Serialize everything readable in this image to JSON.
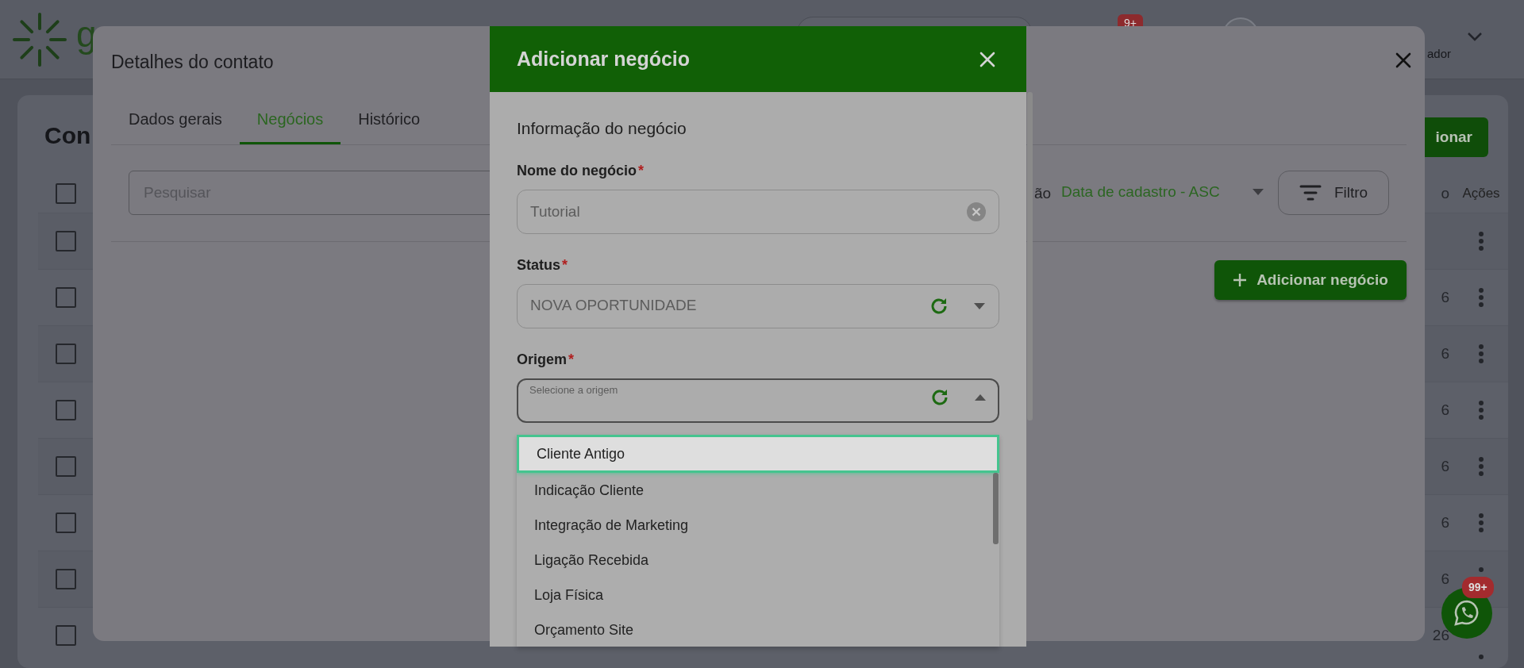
{
  "header": {
    "logo_text": "g",
    "notification_badge": "9+",
    "user_role": "ador"
  },
  "page": {
    "title": "Con",
    "add_button": "ionar",
    "header_checkbox": {
      "checked": false
    },
    "columns": [
      "o",
      "Ações"
    ],
    "rows": [
      {
        "checked": false
      },
      {
        "checked": false,
        "column_1": "6"
      },
      {
        "checked": false,
        "column_1": "6"
      },
      {
        "checked": false,
        "column_1": "6"
      },
      {
        "checked": false,
        "column_1": "6"
      },
      {
        "checked": false,
        "column_1": "6"
      },
      {
        "checked": false,
        "column_1": "6"
      },
      {
        "checked": false,
        "column_1": "26"
      }
    ]
  },
  "contact_modal": {
    "title": "Detalhes do contato",
    "tabs": [
      {
        "label": "Dados gerais",
        "selected": false
      },
      {
        "label": "Negócios",
        "selected": true
      },
      {
        "label": "Histórico",
        "selected": false
      }
    ],
    "search": {
      "placeholder": "Pesquisar"
    },
    "sort_label": "ão",
    "sort_value": "Data de cadastro - ASC",
    "filter_button": "Filtro",
    "add_button": "Adicionar negócio"
  },
  "deal_modal": {
    "title": "Adicionar negócio",
    "section_title": "Informação do negócio",
    "fields": [
      {
        "kind": "text",
        "label": "Nome do negócio",
        "required_mark": "*",
        "value": "Tutorial"
      },
      {
        "kind": "select",
        "label": "Status",
        "required_mark": "*",
        "value": "NOVA OPORTUNIDADE",
        "expanded": false
      },
      {
        "kind": "select",
        "label": "Origem",
        "required_mark": "*",
        "placeholder": "Selecione a origem",
        "expanded": true
      }
    ],
    "options": [
      {
        "label": "Cliente Antigo",
        "selected": true
      },
      {
        "label": "Indicação Cliente",
        "selected": false
      },
      {
        "label": "Integração de Marketing",
        "selected": false
      },
      {
        "label": "Ligação Recebida",
        "selected": false
      },
      {
        "label": "Loja Física",
        "selected": false
      },
      {
        "label": "Orçamento Site",
        "selected": false
      }
    ]
  },
  "chat_button": {
    "badge": "99+"
  }
}
